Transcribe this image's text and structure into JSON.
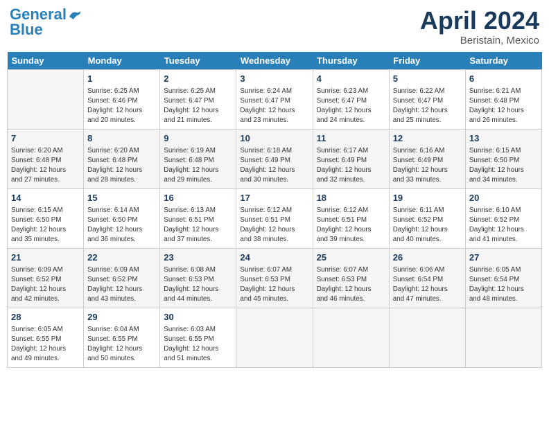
{
  "header": {
    "logo_line1": "General",
    "logo_line2": "Blue",
    "month": "April 2024",
    "location": "Beristain, Mexico"
  },
  "days_of_week": [
    "Sunday",
    "Monday",
    "Tuesday",
    "Wednesday",
    "Thursday",
    "Friday",
    "Saturday"
  ],
  "weeks": [
    [
      {
        "num": "",
        "info": ""
      },
      {
        "num": "1",
        "info": "Sunrise: 6:25 AM\nSunset: 6:46 PM\nDaylight: 12 hours\nand 20 minutes."
      },
      {
        "num": "2",
        "info": "Sunrise: 6:25 AM\nSunset: 6:47 PM\nDaylight: 12 hours\nand 21 minutes."
      },
      {
        "num": "3",
        "info": "Sunrise: 6:24 AM\nSunset: 6:47 PM\nDaylight: 12 hours\nand 23 minutes."
      },
      {
        "num": "4",
        "info": "Sunrise: 6:23 AM\nSunset: 6:47 PM\nDaylight: 12 hours\nand 24 minutes."
      },
      {
        "num": "5",
        "info": "Sunrise: 6:22 AM\nSunset: 6:47 PM\nDaylight: 12 hours\nand 25 minutes."
      },
      {
        "num": "6",
        "info": "Sunrise: 6:21 AM\nSunset: 6:48 PM\nDaylight: 12 hours\nand 26 minutes."
      }
    ],
    [
      {
        "num": "7",
        "info": "Sunrise: 6:20 AM\nSunset: 6:48 PM\nDaylight: 12 hours\nand 27 minutes."
      },
      {
        "num": "8",
        "info": "Sunrise: 6:20 AM\nSunset: 6:48 PM\nDaylight: 12 hours\nand 28 minutes."
      },
      {
        "num": "9",
        "info": "Sunrise: 6:19 AM\nSunset: 6:48 PM\nDaylight: 12 hours\nand 29 minutes."
      },
      {
        "num": "10",
        "info": "Sunrise: 6:18 AM\nSunset: 6:49 PM\nDaylight: 12 hours\nand 30 minutes."
      },
      {
        "num": "11",
        "info": "Sunrise: 6:17 AM\nSunset: 6:49 PM\nDaylight: 12 hours\nand 32 minutes."
      },
      {
        "num": "12",
        "info": "Sunrise: 6:16 AM\nSunset: 6:49 PM\nDaylight: 12 hours\nand 33 minutes."
      },
      {
        "num": "13",
        "info": "Sunrise: 6:15 AM\nSunset: 6:50 PM\nDaylight: 12 hours\nand 34 minutes."
      }
    ],
    [
      {
        "num": "14",
        "info": "Sunrise: 6:15 AM\nSunset: 6:50 PM\nDaylight: 12 hours\nand 35 minutes."
      },
      {
        "num": "15",
        "info": "Sunrise: 6:14 AM\nSunset: 6:50 PM\nDaylight: 12 hours\nand 36 minutes."
      },
      {
        "num": "16",
        "info": "Sunrise: 6:13 AM\nSunset: 6:51 PM\nDaylight: 12 hours\nand 37 minutes."
      },
      {
        "num": "17",
        "info": "Sunrise: 6:12 AM\nSunset: 6:51 PM\nDaylight: 12 hours\nand 38 minutes."
      },
      {
        "num": "18",
        "info": "Sunrise: 6:12 AM\nSunset: 6:51 PM\nDaylight: 12 hours\nand 39 minutes."
      },
      {
        "num": "19",
        "info": "Sunrise: 6:11 AM\nSunset: 6:52 PM\nDaylight: 12 hours\nand 40 minutes."
      },
      {
        "num": "20",
        "info": "Sunrise: 6:10 AM\nSunset: 6:52 PM\nDaylight: 12 hours\nand 41 minutes."
      }
    ],
    [
      {
        "num": "21",
        "info": "Sunrise: 6:09 AM\nSunset: 6:52 PM\nDaylight: 12 hours\nand 42 minutes."
      },
      {
        "num": "22",
        "info": "Sunrise: 6:09 AM\nSunset: 6:52 PM\nDaylight: 12 hours\nand 43 minutes."
      },
      {
        "num": "23",
        "info": "Sunrise: 6:08 AM\nSunset: 6:53 PM\nDaylight: 12 hours\nand 44 minutes."
      },
      {
        "num": "24",
        "info": "Sunrise: 6:07 AM\nSunset: 6:53 PM\nDaylight: 12 hours\nand 45 minutes."
      },
      {
        "num": "25",
        "info": "Sunrise: 6:07 AM\nSunset: 6:53 PM\nDaylight: 12 hours\nand 46 minutes."
      },
      {
        "num": "26",
        "info": "Sunrise: 6:06 AM\nSunset: 6:54 PM\nDaylight: 12 hours\nand 47 minutes."
      },
      {
        "num": "27",
        "info": "Sunrise: 6:05 AM\nSunset: 6:54 PM\nDaylight: 12 hours\nand 48 minutes."
      }
    ],
    [
      {
        "num": "28",
        "info": "Sunrise: 6:05 AM\nSunset: 6:55 PM\nDaylight: 12 hours\nand 49 minutes."
      },
      {
        "num": "29",
        "info": "Sunrise: 6:04 AM\nSunset: 6:55 PM\nDaylight: 12 hours\nand 50 minutes."
      },
      {
        "num": "30",
        "info": "Sunrise: 6:03 AM\nSunset: 6:55 PM\nDaylight: 12 hours\nand 51 minutes."
      },
      {
        "num": "",
        "info": ""
      },
      {
        "num": "",
        "info": ""
      },
      {
        "num": "",
        "info": ""
      },
      {
        "num": "",
        "info": ""
      }
    ]
  ]
}
